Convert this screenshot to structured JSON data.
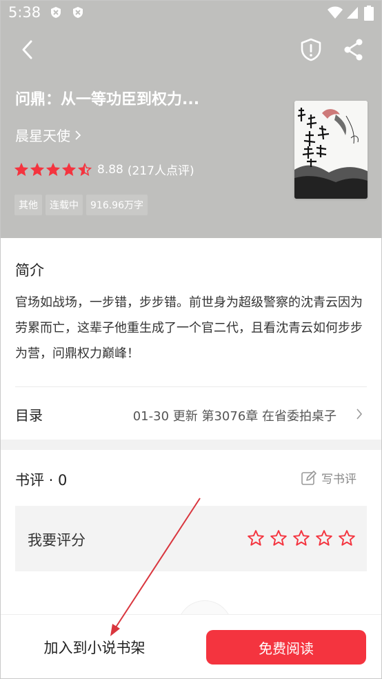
{
  "status_bar": {
    "time": "5:38"
  },
  "header": {
    "book_title": "问鼎：从一等功臣到权力...",
    "author": "晨星天使",
    "rating": "8.88",
    "rating_count": "(217人点评)",
    "stars_filled": 4.5,
    "tags": [
      "其他",
      "连载中",
      "916.96万字"
    ]
  },
  "intro": {
    "title": "简介",
    "text": "官场如战场，一步错，步步错。前世身为超级警察的沈青云因为劳累而亡，这辈子他重生成了一个官二代，且看沈青云如何步步为营，问鼎权力巅峰！"
  },
  "toc": {
    "label": "目录",
    "info": "01-30  更新  第3076章 在省委拍桌子"
  },
  "reviews": {
    "title": "书评 · 0",
    "write_label": "写书评",
    "rate_label": "我要评分",
    "rate_star_count": 5
  },
  "bottom_bar": {
    "shelf_label": "加入到小说书架",
    "read_label": "免费阅读"
  },
  "colors": {
    "accent": "#f4343f",
    "header_bg": "#bfbfbd",
    "annotation_arrow": "#d9363e"
  }
}
